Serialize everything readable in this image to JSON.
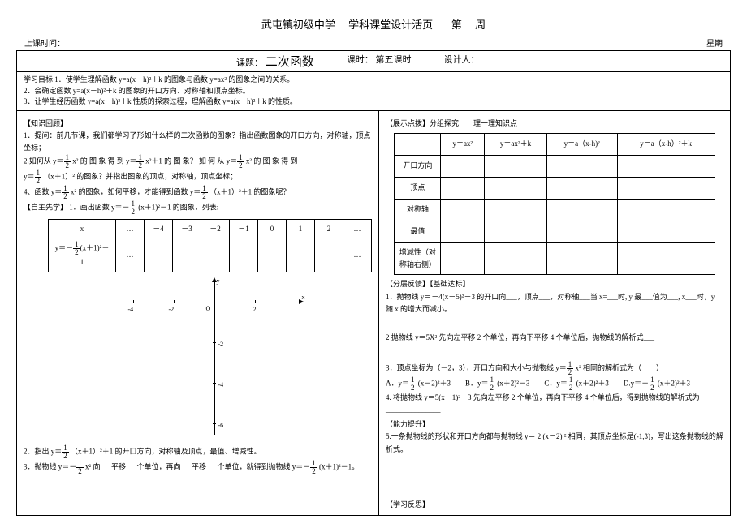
{
  "header": {
    "school": "武屯镇初级中学",
    "doctype": "学科课堂设计活页",
    "week_prefix": "第",
    "week_suffix": "周",
    "class_time": "上课时间：",
    "weekday": "星期"
  },
  "title": {
    "label_topic": "课题：",
    "topic": "二次函数",
    "label_period": "课时：",
    "period": "第五课时",
    "label_designer": "设计人：",
    "designer": ""
  },
  "goals": {
    "label": "学习目标",
    "g1": "1．使学生理解函数 y=a(x－h)²＋k 的图象与函数 y=ax² 的图象之间的关系。",
    "g2": "2．会确定函数 y=a(x－h)²＋k 的图象的开口方向、对称轴和顶点坐标。",
    "g3": "3．让学生经历函数 y=a(x－h)²＋k 性质的探索过程，理解函数 y=a(x－h)²＋k 的性质。"
  },
  "left": {
    "sec1": "【知识回顾】",
    "q1": "1．提问：前几节课，我们都学习了形如什么样的二次函数的图象？指出函数图象的开口方向，对称轴，顶点坐标；",
    "q2a": "2.如何从 y＝",
    "q2b": "x² 的 图 象 得 到 y＝",
    "q2c": "x²＋1 的 图 象？ 如 何 从 y＝",
    "q2d": "x² 的 图 象 得 到",
    "q2e": "y＝",
    "q2f": "（x＋1）² 的图象？并指出图象的顶点，对称轴，顶点坐标；",
    "q4a": "4、函数 y＝",
    "q4b": "x² 的图象，如何平移，才能得到函数 y＝",
    "q4c": "（x＋1）²＋1 的图象呢？",
    "sec2": "【自主先学】",
    "q_plot_a": "1．画出函数 y＝－",
    "q_plot_b": "(x＋1)²－1 的图象，列表:",
    "table_header": "x",
    "table_formula": "y＝－",
    "table_formula2": "(x＋1)²－1",
    "xvals": [
      "…",
      "－4",
      "－3",
      "－2",
      "－1",
      "0",
      "1",
      "2",
      "…"
    ],
    "yvals": [
      "…",
      "",
      "",
      "",
      "",
      "",
      "",
      "",
      "…"
    ],
    "q_after1_a": "2．指出 y＝",
    "q_after1_b": "（x＋1）²＋1 的开口方向，对称轴及顶点，最值、增减性。",
    "q_after2_a": "3．抛物线 y＝－",
    "q_after2_b": "x² 向___平移___个单位，再向___平移___个单位，就得到抛物线 y＝－",
    "q_after2_c": "(x＋1)²－1。"
  },
  "right": {
    "sec1": "【展示点拨】分组探究　　理一理知识点",
    "comp_headers": [
      "",
      "y＝ax²",
      "y＝ax²＋k",
      "y＝a（x-h)²",
      "y＝a（x-h）²＋k"
    ],
    "comp_rows": [
      "开口方向",
      "顶点",
      "对称轴",
      "最值",
      "增减性（对称轴右侧）"
    ],
    "sec2": "【分层反馈】【基础达标】",
    "p1": "1．抛物线 y＝－4(x－5)²－3 的开口向___，顶点___，对称轴___当 x=___时, y 最___值为___, x___时，y 随 x 的增大而减小。",
    "p2": "2 抛物线 y＝5X² 先向左平移 2 个单位，再向下平移 4 个单位后，抛物线的解析式___",
    "p3_a": "3．顶点坐标为（－2，3），开口方向和大小与抛物线 y＝",
    "p3_b": "x² 相同的解析式为（　　）",
    "p3_opts_a": "A．y＝",
    "p3_opts_a2": "(x－2)²＋3　　B．y＝",
    "p3_opts_b2": "(x＋2)²－3　　C．y＝",
    "p3_opts_c2": "(x＋2)²＋3　　D.y＝－",
    "p3_opts_d2": "(x＋2)²＋3",
    "p4": "4.  将抛物线 y＝5(x－1)²＋3 先向左平移 2 个单位，再向下平移 4 个单位后，得到抛物线的解析式为_______________",
    "sec3": "【能力提升】",
    "p5": "5.一条抛物线的形状和开口方向都与抛物线 y＝ 2 (x－2) ² 相同，其顶点坐标是(-1,3)，写出这条抛物线的解析式。",
    "sec4": "【学习反思】"
  },
  "axes": {
    "xlabel": "x",
    "ylabel": "y",
    "origin": "O",
    "xticks": [
      "-4",
      "-2",
      "2"
    ],
    "yticks": [
      "-2",
      "-4",
      "-6"
    ]
  }
}
